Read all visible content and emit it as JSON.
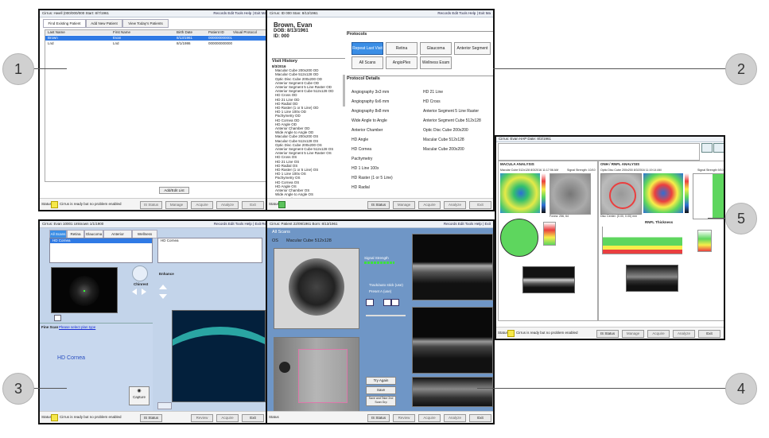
{
  "callouts": [
    "1",
    "2",
    "3",
    "4",
    "5"
  ],
  "panel1": {
    "topbar_left": "Cirrus: Hwell (000/000/000 Start: 8/7/1961",
    "topbar_right": "Records  Edit  Tools  Help  |  Exit Ma",
    "tabs": [
      "Find Existing Patient",
      "Add New Patient",
      "View Today's Patients"
    ],
    "columns": [
      "Last Name",
      "First Name",
      "Birth Date",
      "Patient ID",
      "Visual Protocol"
    ],
    "rows": [
      [
        "Brown",
        "Evan",
        "8/13/1961",
        "000000000001",
        ""
      ],
      [
        "Lnd",
        "Lnd",
        "8/1/1986",
        "000000000000",
        ""
      ]
    ],
    "ok_label": "Add/Edit List",
    "status_text": "Cirrus is ready but no problem enabled",
    "buttons": [
      "IS Status",
      "Manage",
      "Acquire",
      "Analyze",
      "Exit"
    ]
  },
  "panel2": {
    "topbar_left": "Cirrus: ID 000  Stan: 8/13/1961",
    "topbar_right": "Records  Edit  Tools  Help  |  Exit Ma",
    "patient_name": "Brown, Evan",
    "patient_dob": "DOB: 8/13/1961",
    "patient_id": "ID: 000",
    "visit_history_title": "Visit History",
    "visit_date": "8/3/2016",
    "visits": [
      "Macular Cube 200x200 OD",
      "Macular Cube 512x128 OD",
      "Optic Disc Cube 200x200 OD",
      "Anterior Segment Cube OD",
      "Anterior Segment 5 Line Raster OD",
      "Anterior Segment Cube 512x128 OD",
      "HD Cross OD",
      "HD 21 Line OD",
      "HD Radial OD",
      "HD Raster (1 or 5 Line) OD",
      "HD 1 Line 100x OD",
      "Pachymetry OD",
      "HD Cornea OD",
      "HD Angle OD",
      "Anterior Chamber OD",
      "Wide Angle to Angle OD",
      "Macular Cube 200x200 OS",
      "Macular Cube 512x128 OS",
      "Optic Disc Cube 200x200 OS",
      "Anterior Segment Cube 512x128 OS",
      "Anterior Segment 5 Line Raster OS",
      "HD Cross OS",
      "HD 21 Line OS",
      "HD Radial OS",
      "HD Raster (1 or 5 Line) OS",
      "HD 1 Line 100x OS",
      "Pachymetry OS",
      "HD Cornea OS",
      "HD Angle OS",
      "Anterior Chamber OS",
      "Wide Angle to Angle OS",
      "Angiography 3x3 mm OS"
    ],
    "protocols_title": "Protocols",
    "protocols": [
      "Repeat Last Visit",
      "Retina",
      "Glaucoma",
      "Anterior Segment",
      "All Scans",
      "AngioPlex",
      "Wellness Exam"
    ],
    "details_title": "Protocol Details",
    "details_left": [
      "Angiography 3x3 mm",
      "Angiography 6x6 mm",
      "Angiography 8x8 mm",
      "Wide Angle to Angle",
      "Anterior Chamber",
      "HD Angle",
      "HD Cornea",
      "Pachymetry",
      "HD 1 Line 100x",
      "HD Raster (1 or 5 Line)",
      "HD Radial"
    ],
    "details_right": [
      "HD 21 Line",
      "HD Cross",
      "Anterior Segment 5 Line Raster",
      "Anterior Segment Cube 512x128",
      "Optic Disc Cube 200x200",
      "Macular Cube 512x128",
      "Macular Cube 200x200"
    ],
    "buttons": [
      "IS Status",
      "Manage",
      "Acquire",
      "Analyze",
      "Exit"
    ]
  },
  "panel3": {
    "topbar_left": "Cirrus: Evan 10001   Unknown   1/1/1900",
    "topbar_right": "Records  Edit  Tools  Help  |  Exit Re",
    "tabs": [
      "All Scans",
      "Retina",
      "Glaucoma",
      "Anterior Segment",
      "Wellness Exam"
    ],
    "list_item": "HD Cornea",
    "right_item": "HD Cornea",
    "chinrest_label": "Chinrest",
    "enhance_label": "Enhance",
    "scan_label": "Fine Scan",
    "link_text": "Please select plan type",
    "big_label": "HD Cornea",
    "capture_label": "Capture",
    "buttons": [
      "IS Status",
      "Review",
      "Acquire",
      "Exit"
    ],
    "status_text": "Cirrus is ready but no problem enabled"
  },
  "panel4": {
    "topbar_left": "Cirrus: Patient 22/09/1961  Born: 8/13/1961",
    "topbar_right": "Records  Edit  Tools  Help  |  Exit",
    "section_title": "All Scans",
    "eye": "OS",
    "scan_name": "Macular Cube 512x128",
    "signal_label": "Signal Strength",
    "opt1": "Track/auto stick (use)",
    "opt2": "Preset A (use)",
    "btn_try": "Try Again",
    "btn_save": "Save",
    "btn_save_next": "Save and Take 2nd Scan Grp",
    "buttons": [
      "IS Status",
      "Review",
      "Acquire",
      "Analyze",
      "Exit"
    ]
  },
  "panel5": {
    "topbar_left": "Cirrus: Evan   HAP  Date: 8/3/1961",
    "left_title": "MACULA ANALYSIS",
    "right_title": "ONH / RNFL ANALYSIS",
    "left_scan": "Macular Cube 512x128 8/3/2016 11:17:56 AM",
    "right_scan": "Optic Disc Cube 200x200 8/3/2016 11:19:14 AM",
    "signal_left": "Signal Strength: 10/10",
    "signal_right": "Signal Strength 9/10",
    "fovea_label": "Fovea: 256, 64",
    "disc_center": "Disc Center: (0.00, 0.00) mm",
    "rnfl_title": "RNFL Thickness",
    "status_text": "Cirrus is ready but no problem enabled",
    "buttons": [
      "IS Status",
      "Manage",
      "Acquire",
      "Analyze",
      "Exit"
    ],
    "colors": {
      "green": "#5ed65e",
      "yellow": "#f7ee4a",
      "red": "#ea3f3f",
      "blue": "#2d6ed6"
    }
  }
}
